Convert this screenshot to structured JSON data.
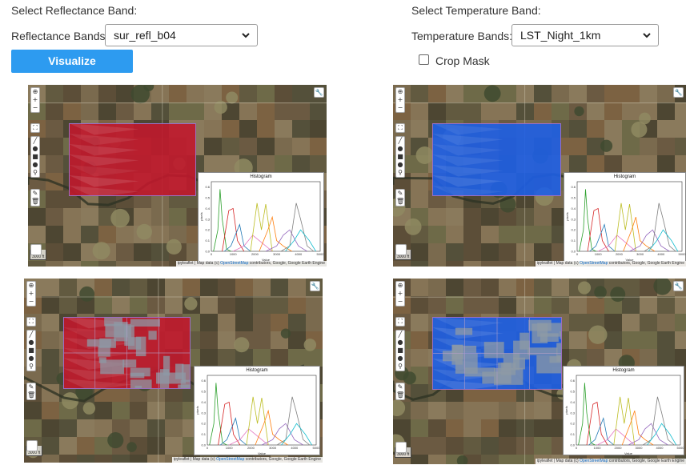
{
  "left_panel": {
    "heading": "Select Reflectance Band:",
    "field_label": "Reflectance Bands:",
    "selected": "sur_refl_b04",
    "button_label": "Visualize"
  },
  "right_panel": {
    "heading": "Select Temperature Band:",
    "field_label": "Temperature Bands:",
    "selected": "LST_Night_1km",
    "checkbox_label": "Crop Mask",
    "checkbox_checked": false
  },
  "map": {
    "zoom_in": "+",
    "zoom_out": "−",
    "scale_km": "1 km",
    "scale_ft": "3000 ft",
    "attribution_prefix": "ipyleaflet | Map data (c) ",
    "attribution_link": "OpenStreetMap",
    "attribution_suffix": " contributors, Google, Google Earth Engine",
    "histogram_title": "Histogram",
    "x_label": "Value",
    "y_label": "pixels",
    "x_ticks": [
      "0",
      "1000",
      "2000",
      "3000",
      "4000",
      "5000"
    ],
    "y_ticks": [
      "0.0",
      "0.1",
      "0.2",
      "0.3",
      "0.4",
      "0.5",
      "0.6"
    ]
  },
  "colors": {
    "button": "#2d9bf0",
    "reflectance_layer": "#c0182c",
    "temperature_layer": "#1e5fe6",
    "series": [
      "#2ca02c",
      "#d62728",
      "#1f77b4",
      "#e377c2",
      "#bcbd22",
      "#ff7f0e",
      "#9467bd",
      "#7f7f7f",
      "#17becf"
    ]
  },
  "chart_data": {
    "type": "line",
    "title": "Histogram",
    "xlabel": "Value",
    "ylabel": "pixels",
    "xlim": [
      0,
      5000
    ],
    "ylim": [
      0,
      0.65
    ],
    "series": [
      {
        "color": "#2ca02c",
        "x": [
          100,
          300,
          400,
          500,
          700,
          900
        ],
        "y": [
          0.0,
          0.2,
          0.58,
          0.3,
          0.02,
          0.0
        ]
      },
      {
        "color": "#d62728",
        "x": [
          500,
          800,
          1000,
          1200,
          1500
        ],
        "y": [
          0.0,
          0.38,
          0.4,
          0.1,
          0.0
        ]
      },
      {
        "color": "#1f77b4",
        "x": [
          600,
          900,
          1300,
          1500,
          1800
        ],
        "y": [
          0.0,
          0.05,
          0.25,
          0.05,
          0.0
        ]
      },
      {
        "color": "#e377c2",
        "x": [
          1000,
          1500,
          1900,
          2200,
          2500,
          2800
        ],
        "y": [
          0.0,
          0.05,
          0.15,
          0.1,
          0.05,
          0.0
        ]
      },
      {
        "color": "#bcbd22",
        "x": [
          1800,
          2100,
          2300,
          2500,
          2800
        ],
        "y": [
          0.0,
          0.45,
          0.2,
          0.44,
          0.0
        ]
      },
      {
        "color": "#ff7f0e",
        "x": [
          2200,
          2600,
          2800,
          3000,
          3300,
          3700
        ],
        "y": [
          0.0,
          0.2,
          0.32,
          0.1,
          0.05,
          0.0
        ]
      },
      {
        "color": "#9467bd",
        "x": [
          2500,
          3000,
          3300,
          3600,
          4000,
          4400
        ],
        "y": [
          0.0,
          0.05,
          0.15,
          0.2,
          0.05,
          0.0
        ]
      },
      {
        "color": "#7f7f7f",
        "x": [
          3200,
          3600,
          3900,
          4100,
          4400,
          4700
        ],
        "y": [
          0.0,
          0.05,
          0.45,
          0.3,
          0.05,
          0.0
        ]
      },
      {
        "color": "#17becf",
        "x": [
          3400,
          3800,
          4100,
          4500,
          4800
        ],
        "y": [
          0.0,
          0.1,
          0.2,
          0.1,
          0.0
        ]
      }
    ]
  }
}
